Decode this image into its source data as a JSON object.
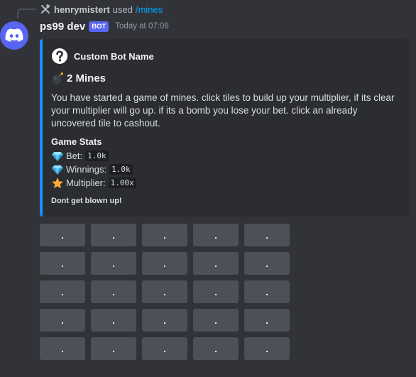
{
  "command": {
    "user": "henrymistert",
    "used_text": "used",
    "command_name": "/mines"
  },
  "message": {
    "bot_name": "ps99 dev",
    "badge": "BOT",
    "timestamp": "Today at 07:06"
  },
  "embed": {
    "accent_color": "#1e90ff",
    "author_name": "Custom Bot Name",
    "title": "2 Mines",
    "description": "You have started a game of mines. click tiles to build up your multiplier, if its clear your multiplier will go up. if its a bomb you lose your bet. click an already uncovered tile to cashout.",
    "field_name": "Game Stats",
    "stats": [
      {
        "icon": "gem-icon",
        "label": "Bet:",
        "value": "1.0k"
      },
      {
        "icon": "gem-icon",
        "label": "Winnings:",
        "value": "1.0k"
      },
      {
        "icon": "star-icon",
        "label": "Multiplier:",
        "value": "1.00x"
      }
    ],
    "footer": "Dont get blown up!"
  },
  "grid": {
    "tile_label": ".",
    "rows": 5,
    "cols": 5
  }
}
